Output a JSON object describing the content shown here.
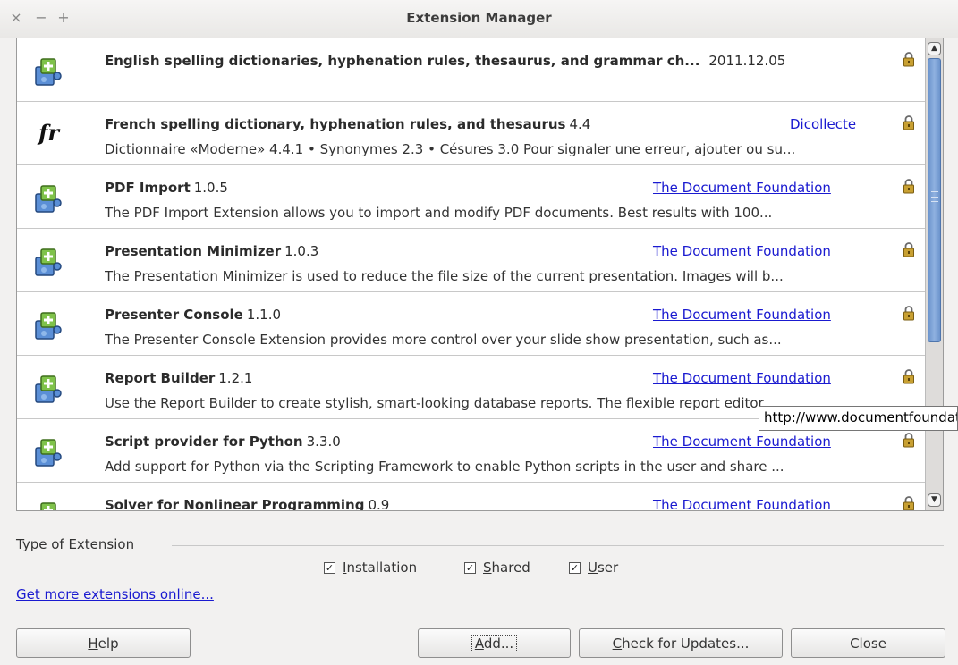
{
  "window": {
    "title": "Extension Manager",
    "controls": [
      "×",
      "−",
      "+"
    ]
  },
  "extensions": [
    {
      "name": "English spelling dictionaries, hyphenation rules, thesaurus, and grammar ch...",
      "version": "2011.12.05",
      "publisher": "",
      "description": "",
      "icon": "puzzle-icon"
    },
    {
      "name": "French spelling dictionary, hyphenation rules, and thesaurus",
      "version": "4.4",
      "publisher": "Dicollecte",
      "description": "Dictionnaire «Moderne» 4.4.1 • Synonymes 2.3 • Césures 3.0 Pour signaler une erreur, ajouter ou su...",
      "icon": "fr-icon",
      "icon_text": "fr"
    },
    {
      "name": "PDF Import",
      "version": "1.0.5",
      "publisher": "The Document Foundation",
      "description": "The PDF Import Extension allows you to import and modify PDF documents. Best results with 100...",
      "icon": "puzzle-icon"
    },
    {
      "name": "Presentation Minimizer",
      "version": "1.0.3",
      "publisher": "The Document Foundation",
      "description": "The Presentation Minimizer is used to reduce the file size of the current presentation. Images will b...",
      "icon": "puzzle-icon"
    },
    {
      "name": "Presenter Console",
      "version": "1.1.0",
      "publisher": "The Document Foundation",
      "description": "The Presenter Console Extension provides more control over your slide show presentation, such as...",
      "icon": "puzzle-icon"
    },
    {
      "name": "Report Builder",
      "version": "1.2.1",
      "publisher": "The Document Foundation",
      "description": "Use the Report Builder to create stylish, smart-looking database reports. The flexible report editor...",
      "icon": "puzzle-icon"
    },
    {
      "name": "Script provider for Python",
      "version": "3.3.0",
      "publisher": "The Document Foundation",
      "description": "Add support for Python via the Scripting Framework to enable Python scripts in the user and share ...",
      "icon": "puzzle-icon"
    },
    {
      "name": "Solver for Nonlinear Programming",
      "version": "0.9",
      "publisher": "The Document Foundation",
      "description": "",
      "icon": "puzzle-icon"
    }
  ],
  "tooltip": "http://www.documentfoundation.org",
  "type_of_extension": {
    "label": "Type of Extension",
    "options": [
      {
        "label": "Installation",
        "accel": "I",
        "rest": "nstallation",
        "checked": true
      },
      {
        "label": "Shared",
        "accel": "S",
        "rest": "hared",
        "checked": true
      },
      {
        "label": "User",
        "accel": "U",
        "rest": "ser",
        "checked": true
      }
    ]
  },
  "more_link": "Get more extensions online...",
  "buttons": {
    "help": {
      "accel": "H",
      "rest": "elp"
    },
    "add": {
      "accel": "A",
      "rest": "dd..."
    },
    "check": {
      "accel": "C",
      "rest": "heck for Updates..."
    },
    "close": "Close"
  },
  "colors": {
    "link": "#1a1ad0",
    "scroll_thumb": "#7da2d6",
    "lock": "#c8a032"
  }
}
